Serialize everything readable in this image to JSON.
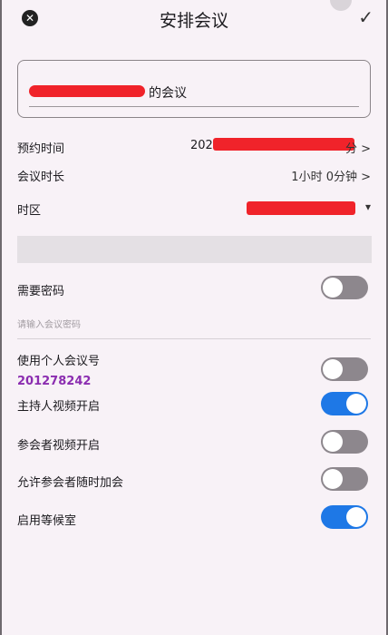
{
  "header": {
    "title": "安排会议",
    "close_icon": "close-icon",
    "confirm_icon": "check-icon"
  },
  "topic": {
    "suffix": "的会议"
  },
  "schedule": {
    "start_label": "预约时间",
    "start_value_prefix": "202",
    "start_value_suffix": "分 >",
    "duration_label": "会议时长",
    "duration_value": "1小时 0分钟 >",
    "timezone_label": "时区",
    "timezone_arrow": "▾"
  },
  "password": {
    "label": "需要密码",
    "enabled": false,
    "placeholder": "请输入会议密码"
  },
  "pmi": {
    "label": "使用个人会议号",
    "number": "201278242",
    "enabled": false
  },
  "options": [
    {
      "label": "主持人视频开启",
      "enabled": true
    },
    {
      "label": "参会者视频开启",
      "enabled": false
    },
    {
      "label": "允许参会者随时加会",
      "enabled": false
    },
    {
      "label": "启用等候室",
      "enabled": true
    }
  ]
}
